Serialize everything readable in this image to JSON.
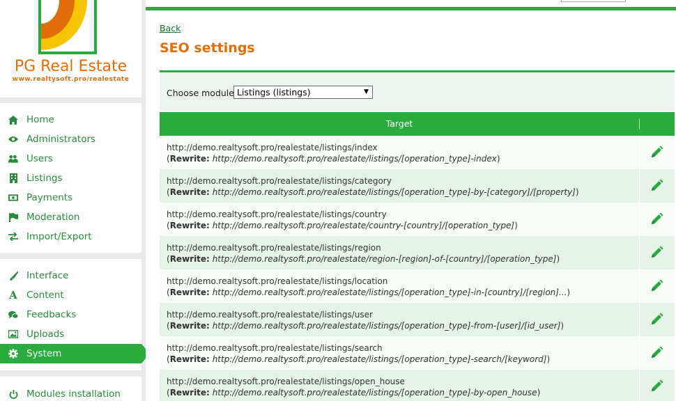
{
  "brand": {
    "name": "PG Real Estate",
    "url": "www.realtysoft.pro/realestate"
  },
  "sidebar": {
    "group1": [
      {
        "label": "Home",
        "icon": "home-icon"
      },
      {
        "label": "Administrators",
        "icon": "eye-icon"
      },
      {
        "label": "Users",
        "icon": "users-icon"
      },
      {
        "label": "Listings",
        "icon": "building-icon"
      },
      {
        "label": "Payments",
        "icon": "money-icon"
      },
      {
        "label": "Moderation",
        "icon": "flag-icon"
      },
      {
        "label": "Import/Export",
        "icon": "exchange-icon"
      }
    ],
    "group2": [
      {
        "label": "Interface",
        "icon": "brush-icon"
      },
      {
        "label": "Content",
        "icon": "font-icon"
      },
      {
        "label": "Feedbacks",
        "icon": "comments-icon"
      },
      {
        "label": "Uploads",
        "icon": "image-icon"
      },
      {
        "label": "System",
        "icon": "gear-icon",
        "active": true
      }
    ],
    "group3": [
      {
        "label": "Modules installation",
        "icon": "power-icon"
      }
    ]
  },
  "main": {
    "back_label": "Back",
    "title": "SEO settings",
    "filter": {
      "label": "Choose module:",
      "selected": "Listings (listings)"
    },
    "table": {
      "header_target": "Target",
      "rewrite_label": "Rewrite:",
      "rows": [
        {
          "url": "http://demo.realtysoft.pro/realestate/listings/index",
          "rewrite": "http://demo.realtysoft.pro/realestate/listings/[operation_type]-index"
        },
        {
          "url": "http://demo.realtysoft.pro/realestate/listings/category",
          "rewrite": "http://demo.realtysoft.pro/realestate/listings/[operation_type]-by-[category]/[property]"
        },
        {
          "url": "http://demo.realtysoft.pro/realestate/listings/country",
          "rewrite": "http://demo.realtysoft.pro/realestate/country-[country]/[operation_type]"
        },
        {
          "url": "http://demo.realtysoft.pro/realestate/listings/region",
          "rewrite": "http://demo.realtysoft.pro/realestate/region-[region]-of-[country]/[operation_type]"
        },
        {
          "url": "http://demo.realtysoft.pro/realestate/listings/location",
          "rewrite": "http://demo.realtysoft.pro/realestate/listings/[operation_type]-in-[country]/[region]..."
        },
        {
          "url": "http://demo.realtysoft.pro/realestate/listings/user",
          "rewrite": "http://demo.realtysoft.pro/realestate/listings/[operation_type]-from-[user]/[id_user]"
        },
        {
          "url": "http://demo.realtysoft.pro/realestate/listings/search",
          "rewrite": "http://demo.realtysoft.pro/realestate/listings/[operation_type]-search/[keyword]"
        },
        {
          "url": "http://demo.realtysoft.pro/realestate/listings/open_house",
          "rewrite": "http://demo.realtysoft.pro/realestate/listings/[operation_type]-by-open_house"
        }
      ]
    }
  },
  "colors": {
    "accent": "#2aab3e",
    "brand_orange": "#e06e0a",
    "logo_yellow": "#f6c300"
  }
}
